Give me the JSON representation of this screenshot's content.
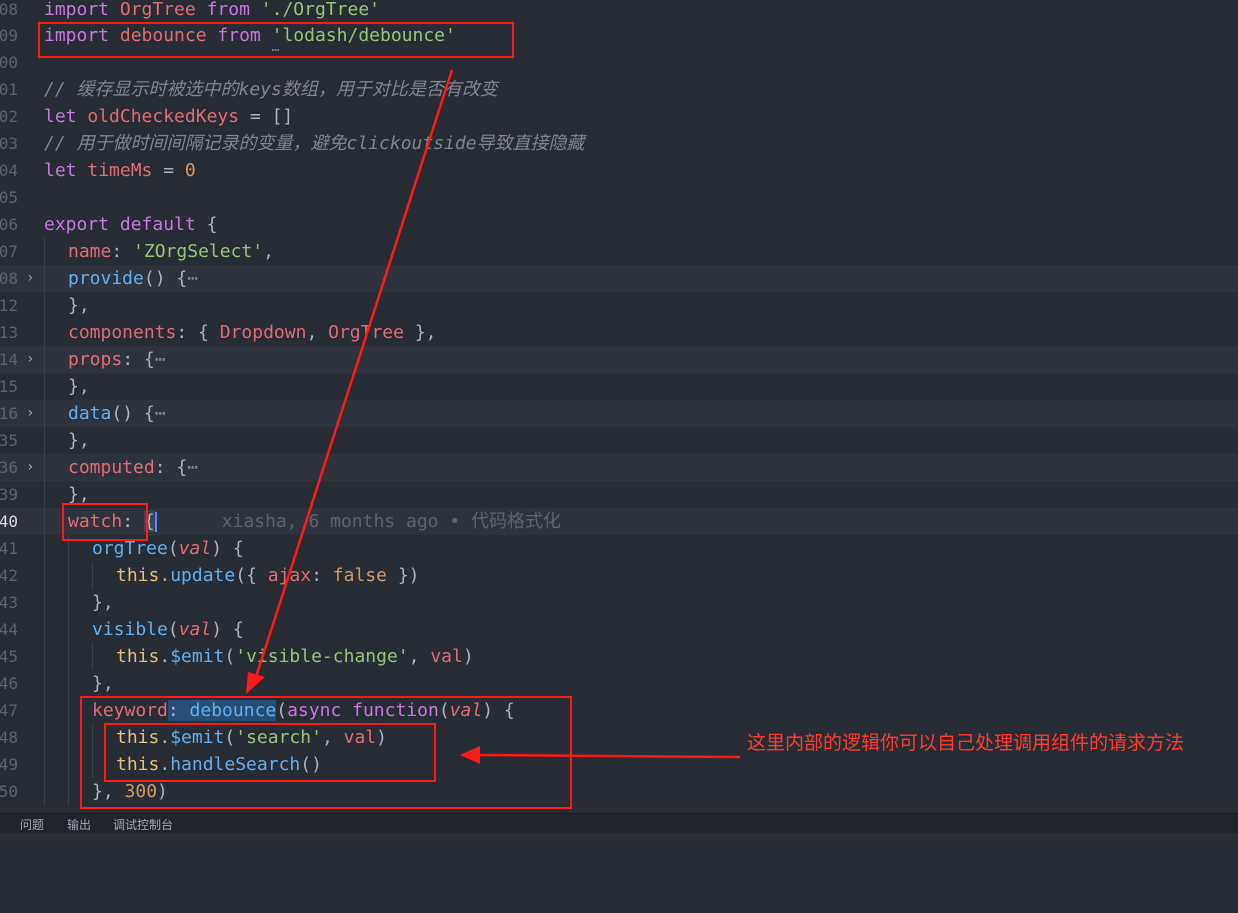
{
  "colors": {
    "annotation": "#ff1a1a",
    "background": "#282c34"
  },
  "editor": {
    "line_numbers": [
      "08",
      "09",
      "00",
      "01",
      "02",
      "03",
      "04",
      "05",
      "06",
      "07",
      "08",
      "12",
      "13",
      "14",
      "15",
      "16",
      "35",
      "36",
      "39",
      "40",
      "41",
      "42",
      "43",
      "44",
      "45",
      "46",
      "47",
      "48",
      "49",
      "50"
    ],
    "import_orgtree": {
      "kw": "import",
      "name": "OrgTree",
      "from": "from",
      "path": "'./OrgTree'"
    },
    "import_debounce": {
      "kw": "import",
      "name": "debounce",
      "from": "from",
      "ellipsis": "…",
      "path": "'lodash/debounce'"
    },
    "comment_keys": "// 缓存显示时被选中的keys数组，用于对比是否有改变",
    "old_keys": {
      "kw": "let",
      "name": "oldCheckedKeys",
      "op": " = ",
      "val": "[]"
    },
    "comment_time": "// 用于做时间间隔记录的变量，避免clickoutside导致直接隐藏",
    "time_ms": {
      "kw": "let",
      "name": "timeMs",
      "op": " = ",
      "val": "0"
    },
    "export_line": {
      "kw1": "export",
      "kw2": "default",
      "brace": " {"
    },
    "name_prop": {
      "key": "name",
      "colon": ": ",
      "val": "'ZOrgSelect'",
      "comma": ","
    },
    "provide": {
      "fn": "provide",
      "rest": "() {",
      "ellipsis": "⋯"
    },
    "close_comma": "},",
    "components": {
      "key": "components",
      "rest1": ": { ",
      "a": "Dropdown",
      "mid": ", ",
      "b": "OrgTree",
      "rest2": " },"
    },
    "props": {
      "key": "props",
      "rest": ": {",
      "ellipsis": "⋯"
    },
    "data_fn": {
      "fn": "data",
      "rest": "() {",
      "ellipsis": "⋯"
    },
    "computed": {
      "key": "computed",
      "rest": ": {",
      "ellipsis": "⋯"
    },
    "watch": {
      "key": "watch",
      "colon": ": ",
      "brace": "{",
      "blame": "xiasha, 6 months ago • 代码格式化"
    },
    "orgtree_watch": {
      "fn": "orgTree",
      "open": "(",
      "param": "val",
      "close": ") {"
    },
    "update_call": {
      "this": "this",
      "dot": ".",
      "fn": "update",
      "open": "({ ",
      "key": "ajax",
      "colon": ": ",
      "val": "false",
      "close": " })"
    },
    "visible_watch": {
      "fn": "visible",
      "open": "(",
      "param": "val",
      "close": ") {"
    },
    "emit_visible": {
      "this": "this",
      "dot": ".",
      "fn": "$emit",
      "open": "(",
      "str": "'visible-change'",
      "mid": ", ",
      "arg": "val",
      "close": ")"
    },
    "keyword_watch": {
      "key": "keyword",
      "colon": ": ",
      "fn": "debounce",
      "open": "(",
      "kw1": "async",
      "kw2": "function",
      "open2": "(",
      "param": "val",
      "close": ") {"
    },
    "emit_search": {
      "this": "this",
      "dot": ".",
      "fn": "$emit",
      "open": "(",
      "str": "'search'",
      "mid": ", ",
      "arg": "val",
      "close": ")"
    },
    "handle_search": {
      "this": "this",
      "dot": ".",
      "fn": "handleSearch",
      "call": "()"
    },
    "debounce_end": {
      "close": "}, ",
      "num": "300",
      "paren": ")"
    }
  },
  "panel": {
    "tabs": [
      "问题",
      "输出",
      "调试控制台"
    ]
  },
  "annotation_note": "这里内部的逻辑你可以自己处理调用组件的请求方法"
}
